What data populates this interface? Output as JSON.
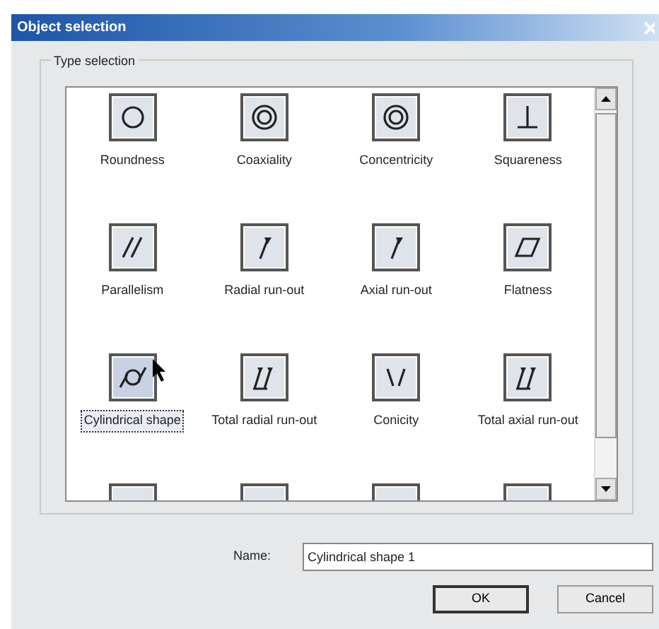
{
  "window": {
    "title": "Object selection"
  },
  "type_selection": {
    "label": "Type selection",
    "items": [
      {
        "label": "Roundness",
        "kind": "circle",
        "selected": false
      },
      {
        "label": "Coaxiality",
        "kind": "rings",
        "selected": false
      },
      {
        "label": "Concentricity",
        "kind": "rings",
        "selected": false
      },
      {
        "label": "Squareness",
        "kind": "perpendicular",
        "selected": false
      },
      {
        "label": "Parallelism",
        "kind": "parallel",
        "selected": false
      },
      {
        "label": "Radial run-out",
        "kind": "runout",
        "selected": false
      },
      {
        "label": "Axial run-out",
        "kind": "runout",
        "selected": false
      },
      {
        "label": "Flatness",
        "kind": "flatness",
        "selected": false
      },
      {
        "label": "Cylindrical shape",
        "kind": "cylinder",
        "selected": true
      },
      {
        "label": "Total radial run-out",
        "kind": "total-runout",
        "selected": false
      },
      {
        "label": "Conicity",
        "kind": "conicity",
        "selected": false
      },
      {
        "label": "Total axial run-out",
        "kind": "total-runout",
        "selected": false
      },
      {
        "kind": "partial",
        "selected": false
      },
      {
        "kind": "partial",
        "selected": false
      },
      {
        "kind": "partial",
        "selected": false
      },
      {
        "kind": "partial",
        "selected": false
      }
    ]
  },
  "name_field": {
    "label": "Name:",
    "value": "Cylindrical shape 1"
  },
  "buttons": [
    {
      "label": "OK",
      "kind": "default"
    },
    {
      "label": "Cancel",
      "kind": "normal"
    }
  ]
}
